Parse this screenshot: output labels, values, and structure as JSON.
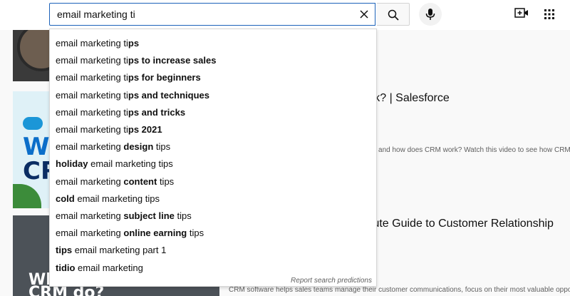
{
  "search": {
    "value": "email marketing ti"
  },
  "suggestions": [
    {
      "plain_before": "email marketing ti",
      "bold": "ps",
      "plain_after": ""
    },
    {
      "plain_before": "email marketing ti",
      "bold": "ps to increase sales",
      "plain_after": ""
    },
    {
      "plain_before": "email marketing ti",
      "bold": "ps for beginners",
      "plain_after": ""
    },
    {
      "plain_before": "email marketing ti",
      "bold": "ps and techniques",
      "plain_after": ""
    },
    {
      "plain_before": "email marketing ti",
      "bold": "ps and tricks",
      "plain_after": ""
    },
    {
      "plain_before": "email marketing ti",
      "bold": "ps 2021",
      "plain_after": ""
    },
    {
      "plain_before": "email marketing ",
      "bold": "design ",
      "plain_after": "tips"
    },
    {
      "plain_before": "",
      "bold": "holiday ",
      "plain_after": "email marketing tips"
    },
    {
      "plain_before": "email marketing ",
      "bold": "content ",
      "plain_after": "tips"
    },
    {
      "plain_before": "",
      "bold": "cold ",
      "plain_after": "email marketing tips"
    },
    {
      "plain_before": "email marketing ",
      "bold": "subject line ",
      "plain_after": "tips"
    },
    {
      "plain_before": "email marketing ",
      "bold": "online earning ",
      "plain_after": "tips"
    },
    {
      "plain_before": "",
      "bold": "tips ",
      "plain_after": "email marketing part 1"
    },
    {
      "plain_before": "",
      "bold": "tidio ",
      "plain_after": "email marketing"
    }
  ],
  "report_label": "Report search predictions",
  "videos": [
    {
      "title_visible": "ork? | Salesforce",
      "desc_visible": "ent) and how does CRM work? Watch this video to see how CRM"
    },
    {
      "title_visible": "inute Guide to Customer Relationship",
      "desc_visible": "CRM software helps sales teams manage their customer communications, focus on their most valuable opportu"
    }
  ],
  "thumb_text": {
    "t2_line1": "WH",
    "t2_line2": "CR",
    "t3_line1": "Wh",
    "t3_line2": "CRM do?"
  },
  "icons": [
    "clear-icon",
    "search-icon",
    "mic-icon",
    "create-video-icon",
    "apps-grid-icon"
  ],
  "colors": {
    "focus_border": "#1c62b9",
    "salesforce_blue": "#1b96d7"
  }
}
